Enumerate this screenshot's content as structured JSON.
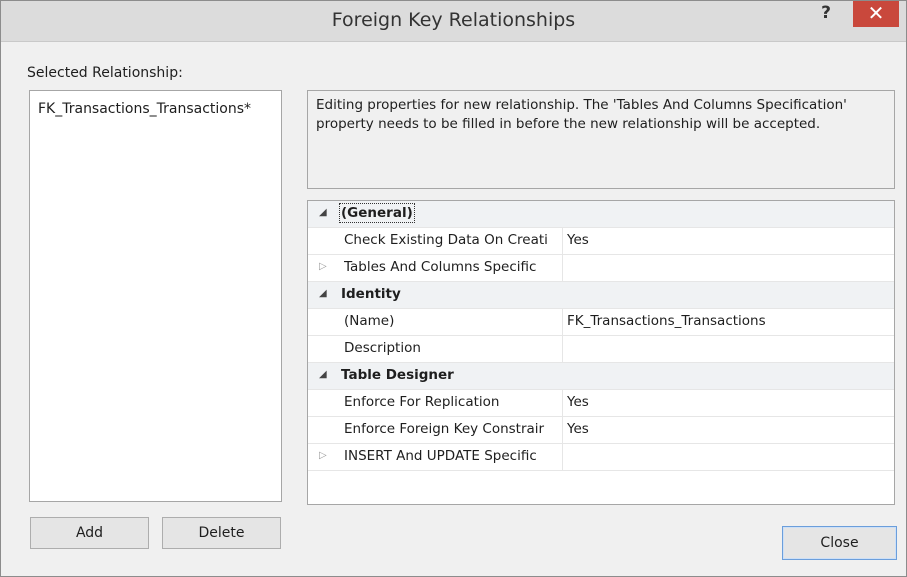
{
  "window": {
    "title": "Foreign Key Relationships",
    "help": "?",
    "close_glyph": "✕"
  },
  "selected_label": "Selected Relationship:",
  "relationships": [
    "FK_Transactions_Transactions*"
  ],
  "info": "Editing properties for new relationship.  The 'Tables And Columns Specification' property needs to be filled in before the new relationship will be accepted.",
  "buttons": {
    "add": "Add",
    "delete": "Delete",
    "close": "Close"
  },
  "grid": {
    "general": "(General)",
    "check_existing": "Check Existing Data On Creati",
    "check_existing_value": "Yes",
    "tables_columns": "Tables And Columns Specific",
    "identity": "Identity",
    "name": "(Name)",
    "name_value": "FK_Transactions_Transactions",
    "description": "Description",
    "table_designer": "Table Designer",
    "enforce_replication": "Enforce For Replication",
    "enforce_replication_value": "Yes",
    "enforce_fk": "Enforce Foreign Key Constrair",
    "enforce_fk_value": "Yes",
    "insert_update": "INSERT And UPDATE Specific"
  },
  "icons": {
    "expanded": "◢",
    "collapsed": "▷"
  }
}
